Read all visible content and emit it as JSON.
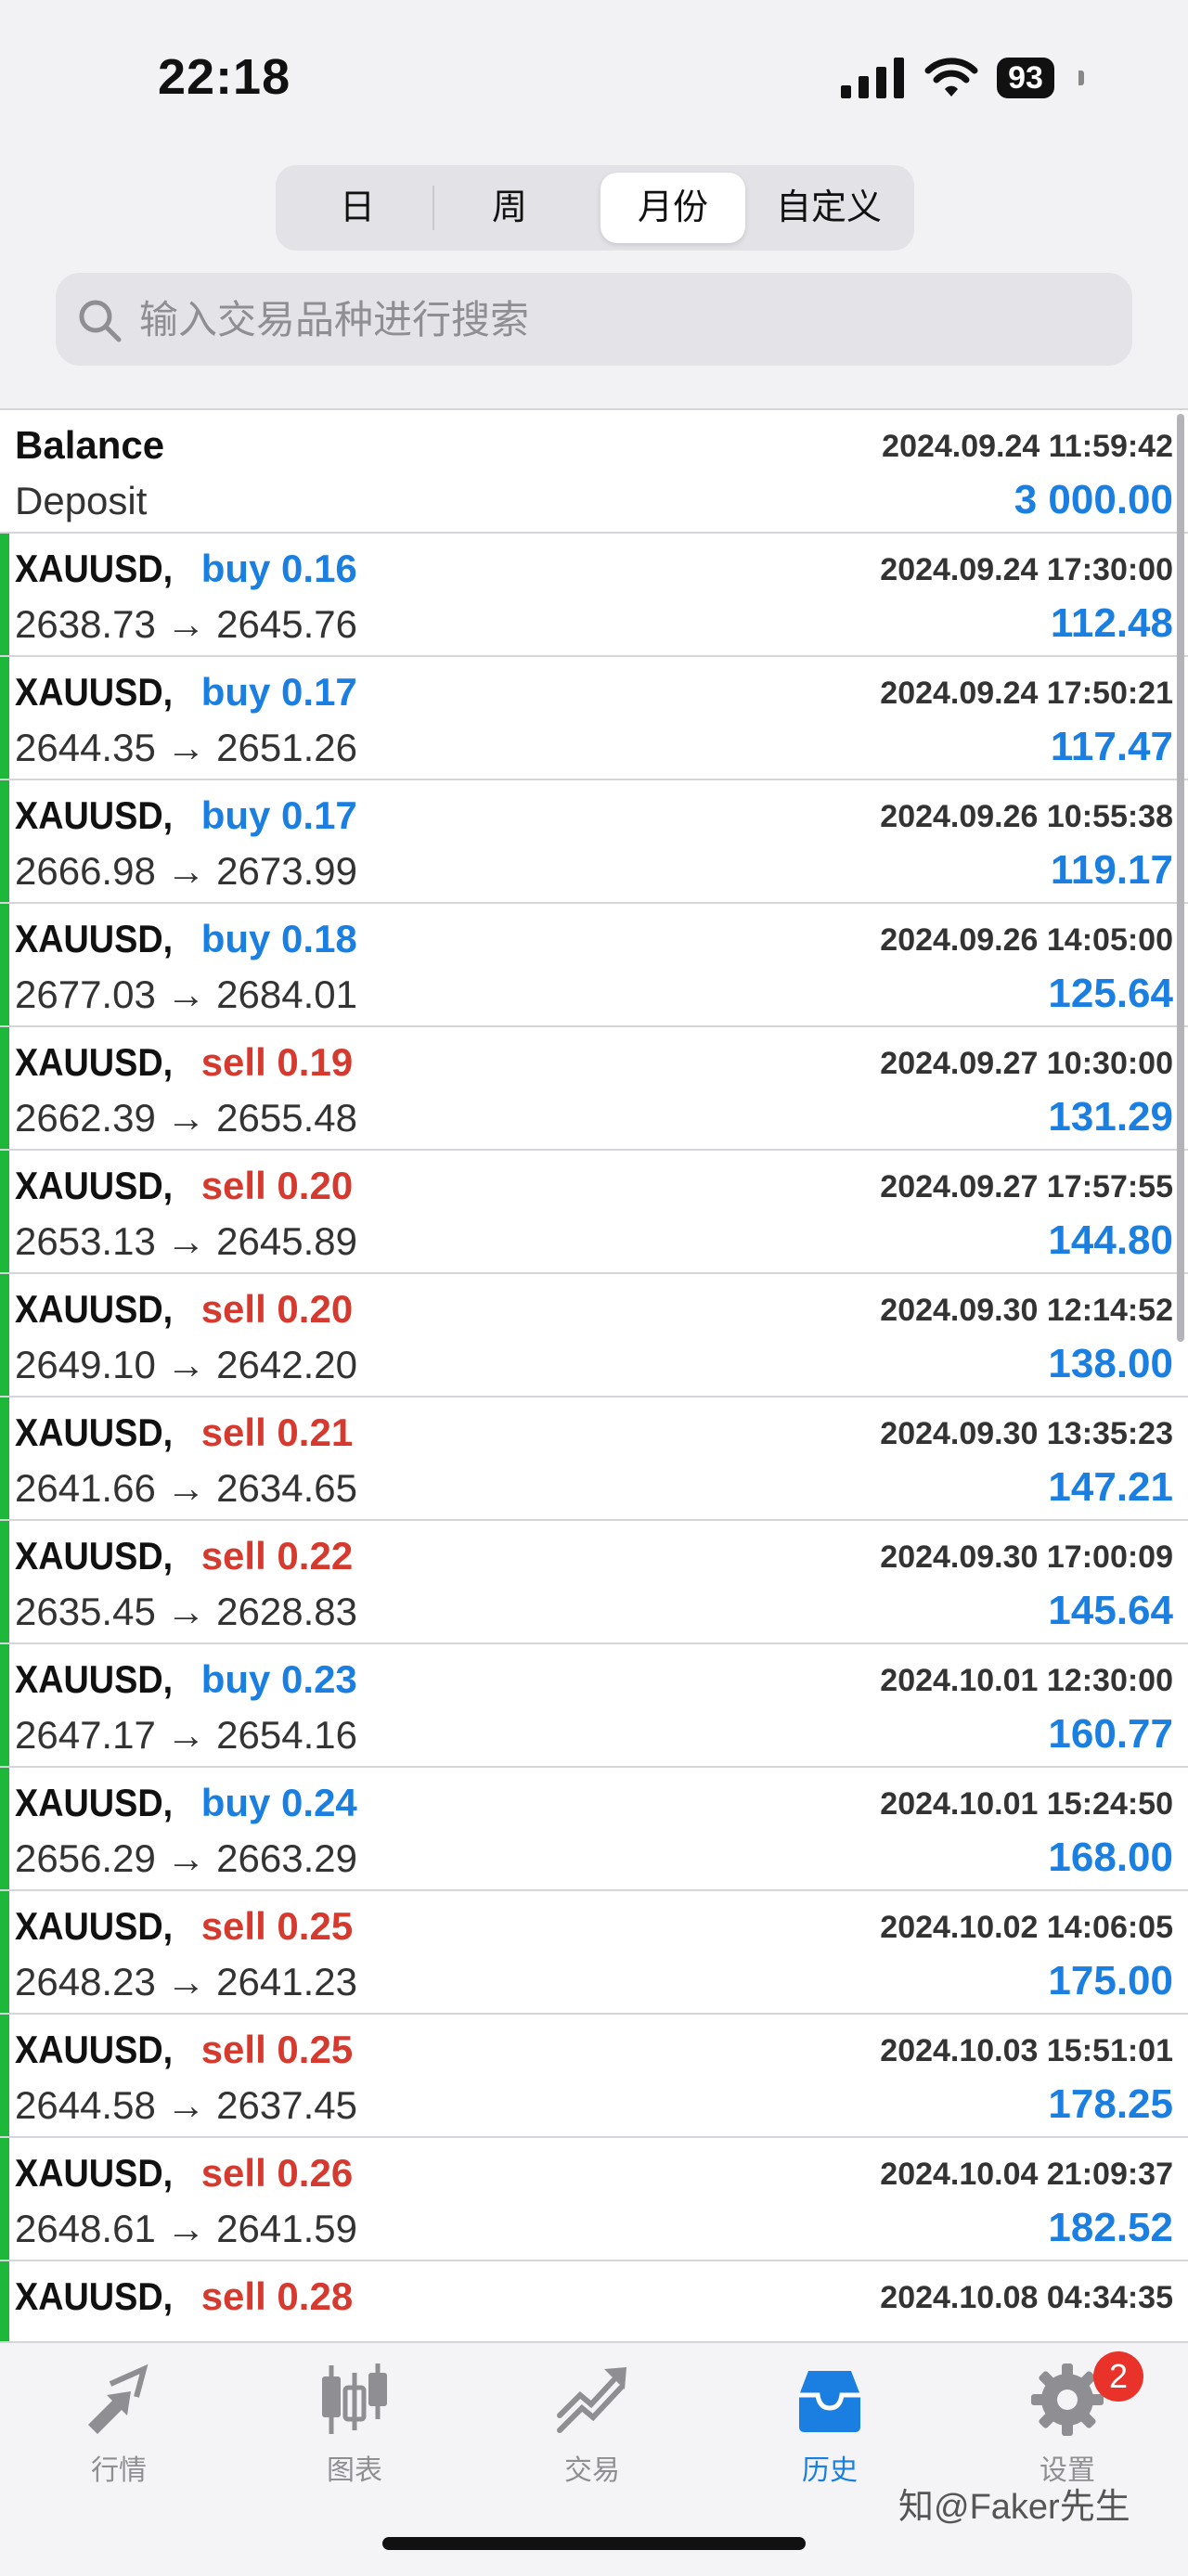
{
  "status_bar": {
    "time": "22:18",
    "battery": "93"
  },
  "period_tabs": [
    {
      "label": "日",
      "active": false
    },
    {
      "label": "周",
      "active": false
    },
    {
      "label": "月份",
      "active": true
    },
    {
      "label": "自定义",
      "active": false
    }
  ],
  "search": {
    "placeholder": "输入交易品种进行搜索"
  },
  "balance_row": {
    "title": "Balance",
    "subtitle": "Deposit",
    "date": "2024.09.24 11:59:42",
    "amount": "3 000.00"
  },
  "trades": [
    {
      "symbol": "XAUUSD,",
      "side": "buy 0.16",
      "type": "buy",
      "prices": "2638.73 → 2645.76",
      "date": "2024.09.24 17:30:00",
      "profit": "112.48"
    },
    {
      "symbol": "XAUUSD,",
      "side": "buy 0.17",
      "type": "buy",
      "prices": "2644.35 → 2651.26",
      "date": "2024.09.24 17:50:21",
      "profit": "117.47"
    },
    {
      "symbol": "XAUUSD,",
      "side": "buy 0.17",
      "type": "buy",
      "prices": "2666.98 → 2673.99",
      "date": "2024.09.26 10:55:38",
      "profit": "119.17"
    },
    {
      "symbol": "XAUUSD,",
      "side": "buy 0.18",
      "type": "buy",
      "prices": "2677.03 → 2684.01",
      "date": "2024.09.26 14:05:00",
      "profit": "125.64"
    },
    {
      "symbol": "XAUUSD,",
      "side": "sell 0.19",
      "type": "sell",
      "prices": "2662.39 → 2655.48",
      "date": "2024.09.27 10:30:00",
      "profit": "131.29"
    },
    {
      "symbol": "XAUUSD,",
      "side": "sell 0.20",
      "type": "sell",
      "prices": "2653.13 → 2645.89",
      "date": "2024.09.27 17:57:55",
      "profit": "144.80"
    },
    {
      "symbol": "XAUUSD,",
      "side": "sell 0.20",
      "type": "sell",
      "prices": "2649.10 → 2642.20",
      "date": "2024.09.30 12:14:52",
      "profit": "138.00"
    },
    {
      "symbol": "XAUUSD,",
      "side": "sell 0.21",
      "type": "sell",
      "prices": "2641.66 → 2634.65",
      "date": "2024.09.30 13:35:23",
      "profit": "147.21"
    },
    {
      "symbol": "XAUUSD,",
      "side": "sell 0.22",
      "type": "sell",
      "prices": "2635.45 → 2628.83",
      "date": "2024.09.30 17:00:09",
      "profit": "145.64"
    },
    {
      "symbol": "XAUUSD,",
      "side": "buy 0.23",
      "type": "buy",
      "prices": "2647.17 → 2654.16",
      "date": "2024.10.01 12:30:00",
      "profit": "160.77"
    },
    {
      "symbol": "XAUUSD,",
      "side": "buy 0.24",
      "type": "buy",
      "prices": "2656.29 → 2663.29",
      "date": "2024.10.01 15:24:50",
      "profit": "168.00"
    },
    {
      "symbol": "XAUUSD,",
      "side": "sell 0.25",
      "type": "sell",
      "prices": "2648.23 → 2641.23",
      "date": "2024.10.02 14:06:05",
      "profit": "175.00"
    },
    {
      "symbol": "XAUUSD,",
      "side": "sell 0.25",
      "type": "sell",
      "prices": "2644.58 → 2637.45",
      "date": "2024.10.03 15:51:01",
      "profit": "178.25"
    },
    {
      "symbol": "XAUUSD,",
      "side": "sell 0.26",
      "type": "sell",
      "prices": "2648.61 → 2641.59",
      "date": "2024.10.04 21:09:37",
      "profit": "182.52"
    },
    {
      "symbol": "XAUUSD,",
      "side": "sell 0.28",
      "type": "sell",
      "prices": "",
      "date": "2024.10.08 04:34:35",
      "profit": ""
    }
  ],
  "tab_bar": [
    {
      "label": "行情",
      "icon": "quotes-icon",
      "active": false
    },
    {
      "label": "图表",
      "icon": "chart-icon",
      "active": false
    },
    {
      "label": "交易",
      "icon": "trade-icon",
      "active": false
    },
    {
      "label": "历史",
      "icon": "history-icon",
      "active": true
    },
    {
      "label": "设置",
      "icon": "settings-icon",
      "active": false
    }
  ],
  "settings_badge": "2",
  "watermark": "知@Faker先生",
  "colors": {
    "buy": "#1a7fe0",
    "sell": "#d63a2f",
    "profit": "#1a7fe0",
    "accent_bar": "#1db83a",
    "active_tab": "#1a7fe0"
  }
}
